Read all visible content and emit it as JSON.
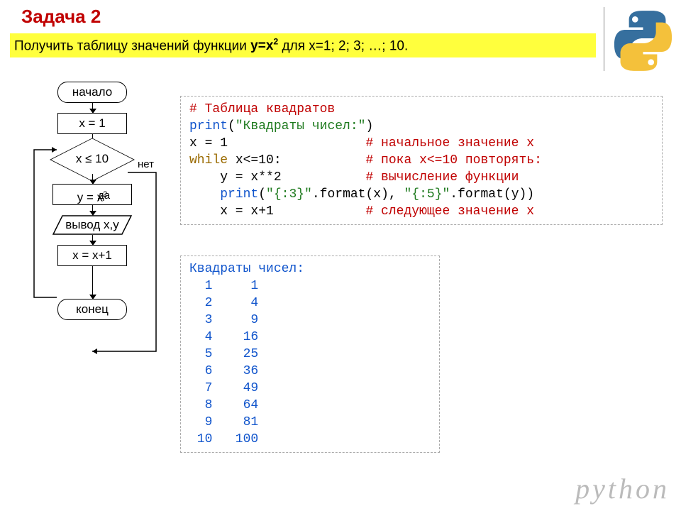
{
  "title": "Задача 2",
  "subtitle_prefix": "Получить таблицу значений функции ",
  "subtitle_func": "y=x",
  "subtitle_exp": "2",
  "subtitle_suffix": " для x=1; 2; 3; …; 10.",
  "flow": {
    "start": "начало",
    "init": "x = 1",
    "cond": "x ≤ 10",
    "yes": "да",
    "no": "нет",
    "calc_a": "y = x",
    "calc_exp": "2",
    "out": "вывод x,y",
    "inc": "x = x+1",
    "end": "конец"
  },
  "code": {
    "c1": "# Таблица квадратов",
    "l2a": "print",
    "l2b": "(",
    "l2c": "\"Квадраты чисел:\"",
    "l2d": ")",
    "l3a": "x = 1                  ",
    "l3b": "# начальное значение x",
    "l4a": "while",
    "l4b": " x<=10:           ",
    "l4c": "# пока x<=10 повторять:",
    "l5a": "    y = x**2           ",
    "l5b": "# вычисление функции",
    "l6a": "    ",
    "l6b": "print",
    "l6c": "(",
    "l6d": "\"{:3}\"",
    "l6e": ".format(x), ",
    "l6f": "\"{:5}\"",
    "l6g": ".format(y))",
    "l7a": "    x = x+1            ",
    "l7b": "# следующее значение x"
  },
  "output": {
    "head": "Квадраты чисел:",
    "rows": "  1     1\n  2     4\n  3     9\n  4    16\n  5    25\n  6    36\n  7    49\n  8    64\n  9    81\n 10   100"
  },
  "footer": "python"
}
